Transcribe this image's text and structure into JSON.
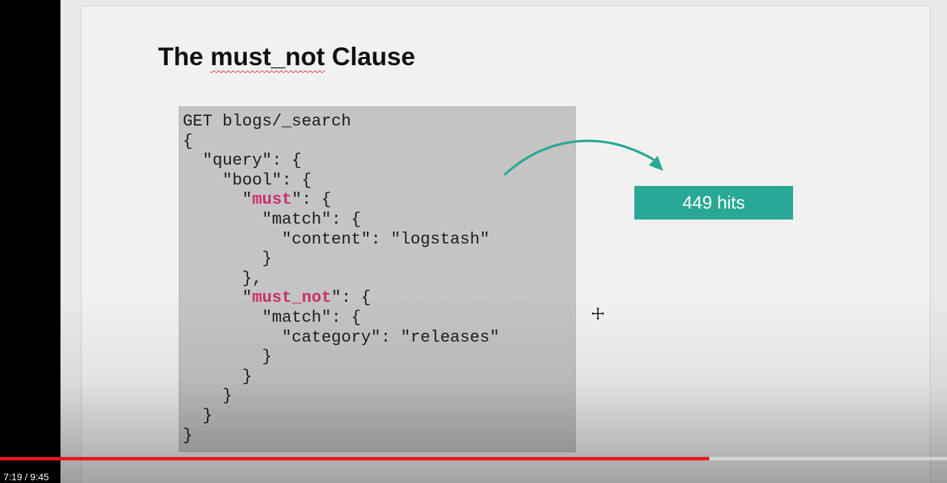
{
  "slide": {
    "title_prefix": "The ",
    "title_term": "must_not",
    "title_suffix": " Clause"
  },
  "code": {
    "lines": [
      [
        {
          "t": "GET blogs/_search"
        }
      ],
      [
        {
          "t": "{"
        }
      ],
      [
        {
          "t": "  \"query\": {"
        }
      ],
      [
        {
          "t": "    \"bool\": {"
        }
      ],
      [
        {
          "t": "      \""
        },
        {
          "t": "must",
          "kw": true
        },
        {
          "t": "\": {"
        }
      ],
      [
        {
          "t": "        \"match\": {"
        }
      ],
      [
        {
          "t": "          \"content\": \"logstash\""
        }
      ],
      [
        {
          "t": "        }"
        }
      ],
      [
        {
          "t": "      },"
        }
      ],
      [
        {
          "t": "      \""
        },
        {
          "t": "must_not",
          "kw": true
        },
        {
          "t": "\": {"
        }
      ],
      [
        {
          "t": "        \"match\": {"
        }
      ],
      [
        {
          "t": "          \"category\": \"releases\""
        }
      ],
      [
        {
          "t": "        }"
        }
      ],
      [
        {
          "t": "      }"
        }
      ],
      [
        {
          "t": "    }"
        }
      ],
      [
        {
          "t": "  }"
        }
      ],
      [
        {
          "t": "}"
        }
      ]
    ]
  },
  "result": {
    "hits_label": "449 hits"
  },
  "player": {
    "time_display": "7:19 / 9:45",
    "progress_fraction": 0.7487
  },
  "colors": {
    "keyword": "#cc2f6c",
    "accent": "#2aa896",
    "progress": "#e7171f"
  },
  "icons": {
    "cursor": "move-cursor-icon",
    "arrow": "curved-arrow-icon"
  }
}
